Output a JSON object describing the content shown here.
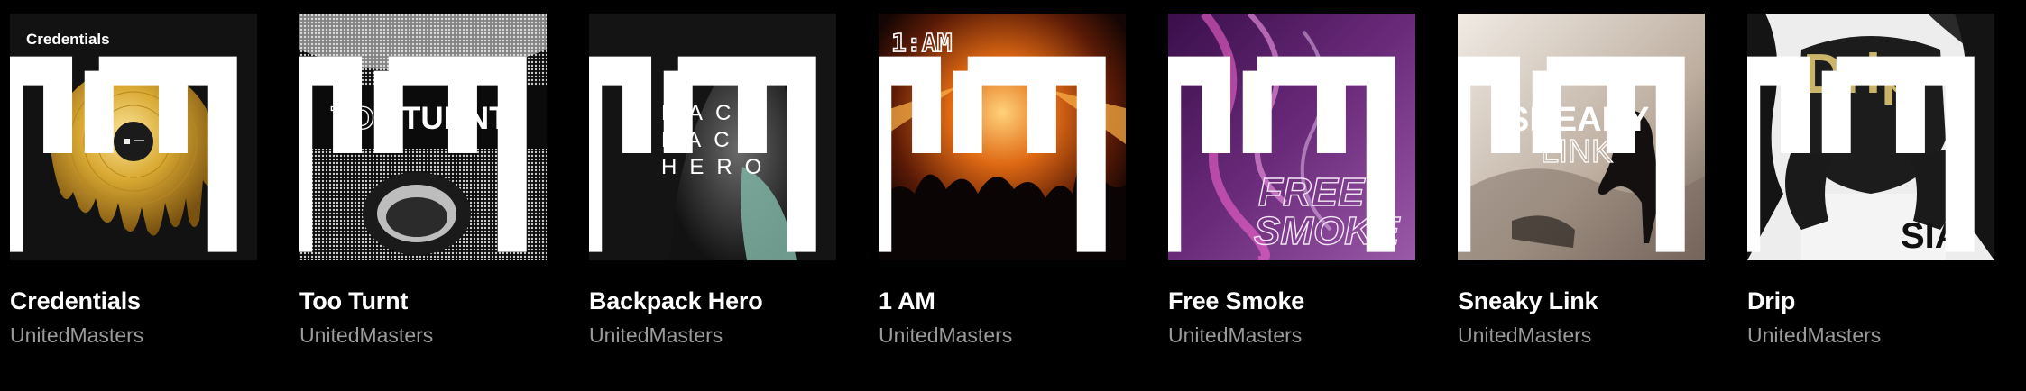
{
  "playlists": [
    {
      "title": "Credentials",
      "subtitle": "UnitedMasters",
      "cover_text": "Credentials",
      "cover_text_2": ""
    },
    {
      "title": "Too Turnt",
      "subtitle": "UnitedMasters",
      "cover_text": "TOO",
      "cover_text_2": "TURNT"
    },
    {
      "title": "Backpack Hero",
      "subtitle": "UnitedMasters",
      "cover_text": "BACK PACK HERO",
      "cover_text_2": ""
    },
    {
      "title": "1 AM",
      "subtitle": "UnitedMasters",
      "cover_text": "1:AM",
      "cover_text_2": ""
    },
    {
      "title": "Free Smoke",
      "subtitle": "UnitedMasters",
      "cover_text": "FREE",
      "cover_text_2": "SMOKE"
    },
    {
      "title": "Sneaky Link",
      "subtitle": "UnitedMasters",
      "cover_text": "SNEAKY",
      "cover_text_2": "LINK"
    },
    {
      "title": "Drip",
      "subtitle": "UnitedMasters",
      "cover_text": "Drip",
      "cover_text_2": ""
    }
  ],
  "colors": {
    "background": "#000000",
    "subtitle": "#9a9a9a",
    "gold": "#d4a72c",
    "drip_gold": "#c9b46a"
  },
  "icons": {
    "brand_mark": "unitedmasters-logo-icon"
  }
}
